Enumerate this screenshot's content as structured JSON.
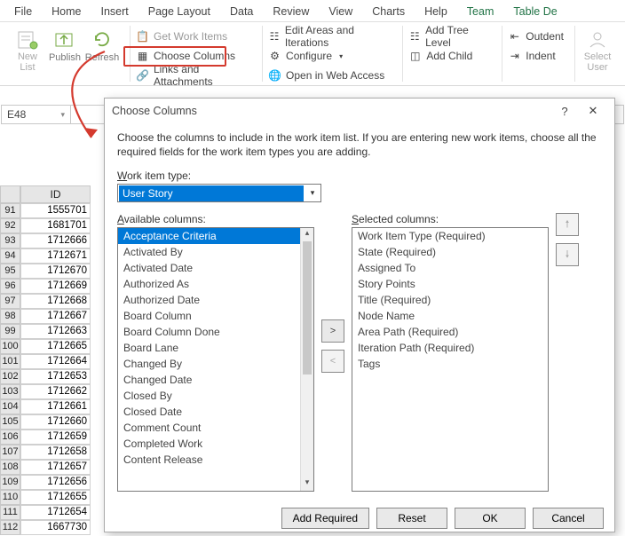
{
  "tabs": [
    "File",
    "Home",
    "Insert",
    "Page Layout",
    "Data",
    "Review",
    "View",
    "Charts",
    "Help",
    "Team",
    "Table De"
  ],
  "active_tab": 9,
  "ribbon": {
    "newlist": "New\nList",
    "publish": "Publish",
    "refresh": "Refresh",
    "getwork": "Get Work Items",
    "choosecols": "Choose Columns",
    "linksatt": "Links and Attachments",
    "editareas": "Edit Areas and Iterations",
    "configure": "Configure",
    "openweb": "Open in Web Access",
    "addtree": "Add Tree Level",
    "addchild": "Add Child",
    "outdent": "Outdent",
    "indent": "Indent",
    "selectuser": "Select\nUser"
  },
  "namebox": "E48",
  "grid": {
    "header": "ID",
    "rows": [
      {
        "n": "91",
        "v": "1555701"
      },
      {
        "n": "92",
        "v": "1681701"
      },
      {
        "n": "93",
        "v": "1712666"
      },
      {
        "n": "94",
        "v": "1712671"
      },
      {
        "n": "95",
        "v": "1712670"
      },
      {
        "n": "96",
        "v": "1712669"
      },
      {
        "n": "97",
        "v": "1712668"
      },
      {
        "n": "98",
        "v": "1712667"
      },
      {
        "n": "99",
        "v": "1712663"
      },
      {
        "n": "100",
        "v": "1712665"
      },
      {
        "n": "101",
        "v": "1712664"
      },
      {
        "n": "102",
        "v": "1712653"
      },
      {
        "n": "103",
        "v": "1712662"
      },
      {
        "n": "104",
        "v": "1712661"
      },
      {
        "n": "105",
        "v": "1712660"
      },
      {
        "n": "106",
        "v": "1712659"
      },
      {
        "n": "107",
        "v": "1712658"
      },
      {
        "n": "108",
        "v": "1712657"
      },
      {
        "n": "109",
        "v": "1712656"
      },
      {
        "n": "110",
        "v": "1712655"
      },
      {
        "n": "111",
        "v": "1712654"
      },
      {
        "n": "112",
        "v": "1667730"
      }
    ]
  },
  "dialog": {
    "title": "Choose Columns",
    "desc": "Choose the columns to include in the work item list.  If you are entering new work items, choose all the required fields for the work item types you are adding.",
    "workitem_label": "Work item type:",
    "workitem_value": "User Story",
    "avail_label": "Available columns:",
    "sel_label": "Selected columns:",
    "available": [
      "Acceptance Criteria",
      "Activated By",
      "Activated Date",
      "Authorized As",
      "Authorized Date",
      "Board Column",
      "Board Column Done",
      "Board Lane",
      "Changed By",
      "Changed Date",
      "Closed By",
      "Closed Date",
      "Comment Count",
      "Completed Work",
      "Content Release"
    ],
    "selected": [
      "Work Item Type (Required)",
      "State (Required)",
      "Assigned To",
      "Story Points",
      "Title (Required)",
      "Node Name",
      "Area Path (Required)",
      "Iteration Path (Required)",
      "Tags"
    ],
    "buttons": {
      "addreq": "Add Required",
      "reset": "Reset",
      "ok": "OK",
      "cancel": "Cancel"
    }
  }
}
